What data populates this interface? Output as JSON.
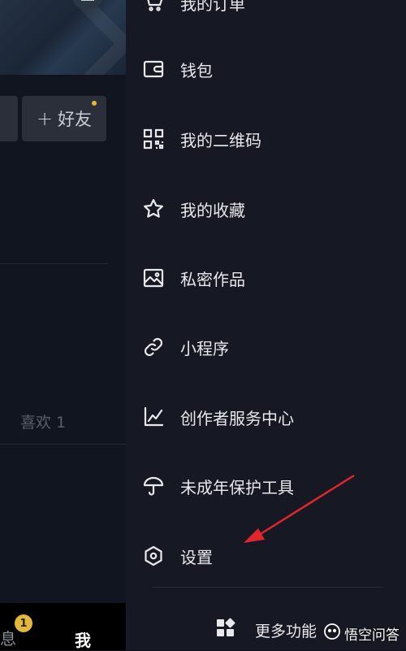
{
  "profile_bg": {
    "add_friend_label": "好友",
    "likes_label": "喜欢 1"
  },
  "bottom_nav": {
    "messages_label": "息",
    "messages_badge": "1",
    "me_label": "我"
  },
  "drawer": {
    "items": [
      {
        "label": "我的订单",
        "icon": "cart-icon"
      },
      {
        "label": "钱包",
        "icon": "wallet-icon"
      },
      {
        "label": "我的二维码",
        "icon": "qr-code-icon"
      },
      {
        "label": "我的收藏",
        "icon": "star-icon"
      },
      {
        "label": "私密作品",
        "icon": "private-image-icon"
      },
      {
        "label": "小程序",
        "icon": "link-icon"
      },
      {
        "label": "创作者服务中心",
        "icon": "chart-line-icon"
      },
      {
        "label": "未成年保护工具",
        "icon": "umbrella-icon"
      },
      {
        "label": "设置",
        "icon": "hexagon-settings-icon"
      }
    ],
    "more_label": "更多功能"
  },
  "watermark": {
    "text": "悟空问答"
  },
  "colors": {
    "drawer_bg": "#161823",
    "annotation_arrow": "#e0262b",
    "badge": "#e2b83a"
  }
}
